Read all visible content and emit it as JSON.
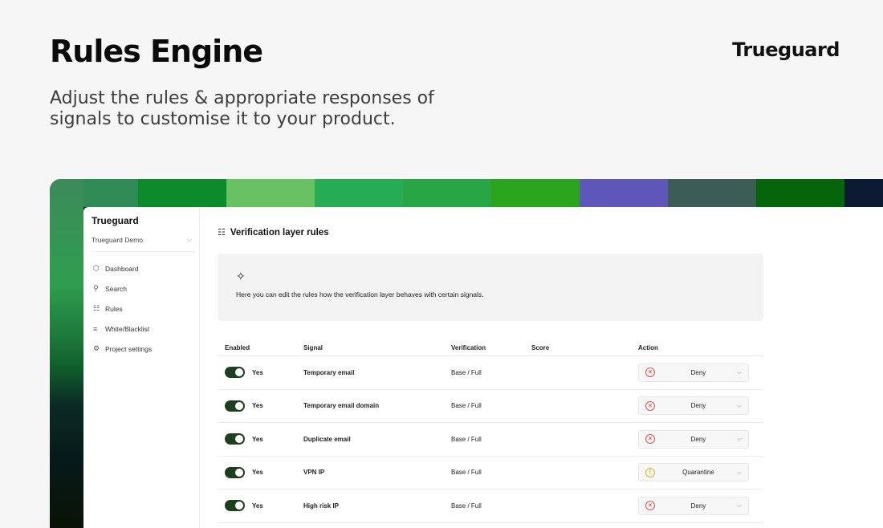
{
  "hero": {
    "title": "Rules Engine",
    "subtitle": "Adjust the rules & appropriate responses of signals to customise it to your product.",
    "brand": "Trueguard"
  },
  "colors": {
    "stripes": [
      "#2f8a55",
      "#0c8a2c",
      "#68c262",
      "#27ac56",
      "#28a646",
      "#2aa51c",
      "#5e56b8",
      "#3b5d55",
      "#06640a",
      "#0d1a34"
    ]
  },
  "sidebar": {
    "brand": "Trueguard",
    "project": "Trueguard Demo",
    "items": [
      {
        "label": "Dashboard",
        "icon": "shield-icon"
      },
      {
        "label": "Search",
        "icon": "search-icon"
      },
      {
        "label": "Rules",
        "icon": "checklist-icon"
      },
      {
        "label": "White/Blacklist",
        "icon": "list-icon"
      },
      {
        "label": "Project settings",
        "icon": "gear-icon"
      }
    ]
  },
  "main": {
    "heading": "Verification layer rules",
    "info_text": "Here you can edit the rules how the verification layer behaves with certain signals.",
    "columns": {
      "enabled": "Enabled",
      "signal": "Signal",
      "verification": "Verification",
      "score": "Score",
      "action": "Action"
    },
    "rows": [
      {
        "enabled": "Yes",
        "signal": "Temporary email",
        "verification": "Base / Full",
        "score": "",
        "action": "Deny",
        "status": "deny"
      },
      {
        "enabled": "Yes",
        "signal": "Temporary email domain",
        "verification": "Base / Full",
        "score": "",
        "action": "Deny",
        "status": "deny"
      },
      {
        "enabled": "Yes",
        "signal": "Duplicate email",
        "verification": "Base / Full",
        "score": "",
        "action": "Deny",
        "status": "deny"
      },
      {
        "enabled": "Yes",
        "signal": "VPN IP",
        "verification": "Base / Full",
        "score": "",
        "action": "Quarantine",
        "status": "quarantine"
      },
      {
        "enabled": "Yes",
        "signal": "High risk IP",
        "verification": "Base / Full",
        "score": "",
        "action": "Deny",
        "status": "deny"
      }
    ]
  }
}
